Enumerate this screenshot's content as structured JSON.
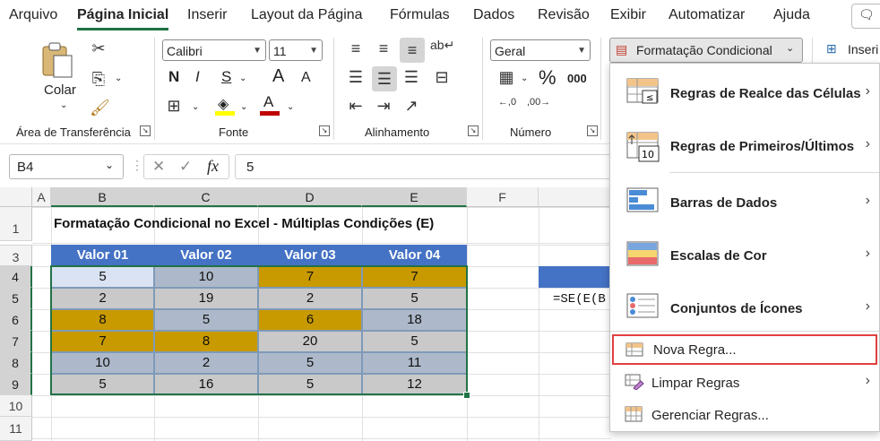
{
  "menu": {
    "tabs": [
      "Arquivo",
      "Página Inicial",
      "Inserir",
      "Layout da Página",
      "Fórmulas",
      "Dados",
      "Revisão",
      "Exibir",
      "Automatizar",
      "Ajuda"
    ],
    "active": "Página Inicial"
  },
  "ribbon": {
    "clipboard": {
      "paste_label": "Colar",
      "group_label": "Área de Transferência"
    },
    "font": {
      "font_name": "Calibri",
      "font_size": "11",
      "bold": "N",
      "italic": "I",
      "underline": "S",
      "grow": "A",
      "shrink": "A",
      "group_label": "Fonte"
    },
    "alignment": {
      "group_label": "Alinhamento"
    },
    "number": {
      "format": "Geral",
      "percent": "%",
      "thousands": "000",
      "group_label": "Número"
    },
    "cond_format_label": "Formatação Condicional",
    "insert_label": "Inseri",
    "colors": {
      "highlight": "#ffff00",
      "font_color": "#c00000"
    }
  },
  "formula_bar": {
    "name_box": "B4",
    "cancel": "✕",
    "enter": "✓",
    "fx": "fx",
    "value": "5"
  },
  "sheet": {
    "columns": [
      "A",
      "B",
      "C",
      "D",
      "E",
      "F"
    ],
    "rows": [
      "1",
      "2",
      "3",
      "4",
      "5",
      "6",
      "7",
      "8",
      "9",
      "10",
      "11"
    ],
    "title": "Formatação Condicional no Excel - Múltiplas Condições (E)",
    "headers": [
      "Valor 01",
      "Valor 02",
      "Valor 03",
      "Valor 04"
    ],
    "values": [
      [
        "5",
        "10",
        "7",
        "7"
      ],
      [
        "2",
        "19",
        "2",
        "5"
      ],
      [
        "8",
        "5",
        "6",
        "18"
      ],
      [
        "7",
        "8",
        "20",
        "5"
      ],
      [
        "10",
        "2",
        "5",
        "11"
      ],
      [
        "5",
        "16",
        "5",
        "12"
      ]
    ],
    "fills": [
      [
        "#dae3f3",
        "#adb9ca",
        "#c89a00",
        "#c89a00"
      ],
      [
        "#c9c9c9",
        "#c9c9c9",
        "#c9c9c9",
        "#c9c9c9"
      ],
      [
        "#c89a00",
        "#adb9ca",
        "#c89a00",
        "#adb9ca"
      ],
      [
        "#c89a00",
        "#c89a00",
        "#c9c9c9",
        "#c9c9c9"
      ],
      [
        "#adb9ca",
        "#adb9ca",
        "#adb9ca",
        "#adb9ca"
      ],
      [
        "#c9c9c9",
        "#c9c9c9",
        "#c9c9c9",
        "#c9c9c9"
      ]
    ],
    "formula_text": "=SE(E(B"
  },
  "cf_menu": {
    "items": [
      {
        "label": "Regras de Realce das Células"
      },
      {
        "label": "Regras de Primeiros/Últimos"
      },
      {
        "label": "Barras de Dados"
      },
      {
        "label": "Escalas de Cor"
      },
      {
        "label": "Conjuntos de Ícones"
      }
    ],
    "new_rule": "Nova Regra...",
    "clear_rules": "Limpar Regras",
    "manage_rules": "Gerenciar Regras...",
    "highlight_border": "#e0403f"
  }
}
